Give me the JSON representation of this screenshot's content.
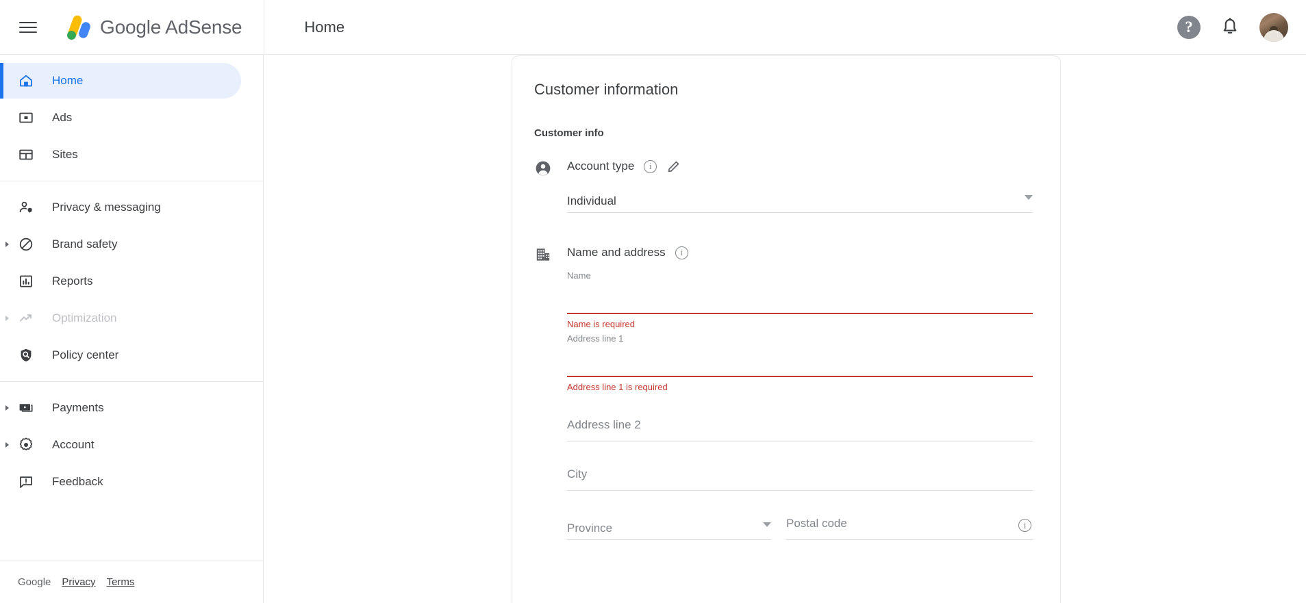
{
  "topbar": {
    "menu_icon": "hamburger-menu-icon",
    "brand": "Google AdSense",
    "page_title": "Home",
    "help_glyph": "?",
    "help_icon": "help-icon",
    "notifications_icon": "bell-icon",
    "avatar_icon": "user-avatar"
  },
  "sidebar": {
    "groups": [
      {
        "items": [
          {
            "label": "Home",
            "icon": "home-icon",
            "active": true,
            "expandable": false,
            "disabled": false
          },
          {
            "label": "Ads",
            "icon": "ads-icon",
            "active": false,
            "expandable": false,
            "disabled": false
          },
          {
            "label": "Sites",
            "icon": "sites-icon",
            "active": false,
            "expandable": false,
            "disabled": false
          }
        ]
      },
      {
        "items": [
          {
            "label": "Privacy & messaging",
            "icon": "privacy-person-shield-icon",
            "active": false,
            "expandable": false,
            "disabled": false
          },
          {
            "label": "Brand safety",
            "icon": "block-circle-icon",
            "active": false,
            "expandable": true,
            "disabled": false
          },
          {
            "label": "Reports",
            "icon": "bar-chart-icon",
            "active": false,
            "expandable": false,
            "disabled": false
          },
          {
            "label": "Optimization",
            "icon": "trending-up-icon",
            "active": false,
            "expandable": true,
            "disabled": true
          },
          {
            "label": "Policy center",
            "icon": "policy-shield-icon",
            "active": false,
            "expandable": false,
            "disabled": false
          }
        ]
      },
      {
        "items": [
          {
            "label": "Payments",
            "icon": "payments-money-icon",
            "active": false,
            "expandable": true,
            "disabled": false
          },
          {
            "label": "Account",
            "icon": "gear-icon",
            "active": false,
            "expandable": true,
            "disabled": false
          },
          {
            "label": "Feedback",
            "icon": "feedback-icon",
            "active": false,
            "expandable": false,
            "disabled": false
          }
        ]
      }
    ],
    "footer": {
      "brand": "Google",
      "privacy_link": "Privacy",
      "terms_link": "Terms"
    }
  },
  "card": {
    "title": "Customer information",
    "section_label": "Customer info",
    "account_type": {
      "icon": "person-circle-icon",
      "label": "Account type",
      "info_icon": "info-icon",
      "edit_icon": "pencil-edit-icon",
      "value": "Individual"
    },
    "name_and_address": {
      "icon": "building-icon",
      "label": "Name and address",
      "info_icon": "info-icon",
      "fields": {
        "name": {
          "label": "Name",
          "value": "",
          "error": "Name is required"
        },
        "address1": {
          "label": "Address line 1",
          "value": "",
          "error": "Address line 1 is required"
        },
        "address2": {
          "placeholder": "Address line 2",
          "value": ""
        },
        "city": {
          "placeholder": "City",
          "value": ""
        },
        "province": {
          "placeholder": "Province",
          "value": ""
        },
        "postal_code": {
          "placeholder": "Postal code",
          "value": "",
          "info_icon": "info-icon"
        }
      }
    }
  },
  "colors": {
    "accent_blue": "#1a73e8",
    "active_bg": "#e8f0fe",
    "error_red": "#c5372c",
    "text_primary": "#3c4043",
    "text_secondary": "#80868b",
    "border": "#e4e6e8"
  }
}
